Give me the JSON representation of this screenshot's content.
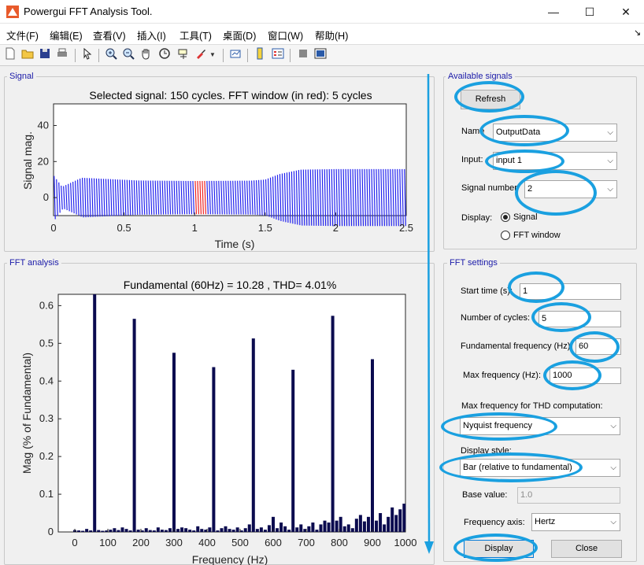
{
  "window": {
    "title": "Powergui FFT Analysis Tool.",
    "minimize": "—",
    "maximize": "☐",
    "close": "✕"
  },
  "menu": [
    "文件(F)",
    "编辑(E)",
    "查看(V)",
    "插入(I)",
    "工具(T)",
    "桌面(D)",
    "窗口(W)",
    "帮助(H)"
  ],
  "menu_arrow": "↘",
  "toolbar_icons": [
    "new-file-icon",
    "open-folder-icon",
    "save-icon",
    "print-icon",
    "pointer-icon",
    "zoom-in-icon",
    "zoom-out-icon",
    "pan-hand-icon",
    "rotate-3d-icon",
    "data-cursor-icon",
    "brush-icon",
    "link-plot-icon",
    "colorbar-icon",
    "legend-icon",
    "hide-plot-tools-icon",
    "show-plot-tools-icon"
  ],
  "signal_panel": {
    "title": "Signal",
    "chart_title": "Selected signal: 150 cycles. FFT window (in red): 5 cycles",
    "xlabel": "Time (s)",
    "ylabel": "Signal mag."
  },
  "fft_panel": {
    "title": "FFT analysis",
    "chart_title": "Fundamental (60Hz) = 10.28 , THD= 4.01%",
    "xlabel": "Frequency (Hz)",
    "ylabel": "Mag (% of Fundamental)"
  },
  "available_signals": {
    "title": "Available signals",
    "refresh": "Refresh",
    "name_label": "Name",
    "name_value": "OutputData",
    "input_label": "Input:",
    "input_value": "input 1",
    "signal_number_label": "Signal number",
    "signal_number_value": "2",
    "display_label": "Display:",
    "display_signal": "Signal",
    "display_fft": "FFT window"
  },
  "fft_settings": {
    "title": "FFT settings",
    "start_time_label": "Start time (s):",
    "start_time_value": "1",
    "cycles_label": "Number of cycles:",
    "cycles_value": "5",
    "fund_freq_label": "Fundamental frequency (Hz):",
    "fund_freq_value": "60",
    "max_freq_label": "Max frequency (Hz):",
    "max_freq_value": "1000",
    "thd_label": "Max frequency for THD computation:",
    "thd_value": "Nyquist frequency",
    "display_style_label": "Display style:",
    "display_style_value": "Bar (relative to fundamental)",
    "base_value_label": "Base value:",
    "base_value_value": "1.0",
    "freq_axis_label": "Frequency axis:",
    "freq_axis_value": "Hertz",
    "display_button": "Display",
    "close_button": "Close"
  },
  "colors": {
    "accent_ring": "#1aa0e0",
    "signal_wave": "#2222ee",
    "fft_window": "#ee2222",
    "bars": "#0b0b4f"
  },
  "chart_data": [
    {
      "type": "line",
      "title": "Selected signal: 150 cycles. FFT window (in red): 5 cycles",
      "xlabel": "Time (s)",
      "ylabel": "Signal mag.",
      "xlim": [
        0,
        2.5
      ],
      "ylim": [
        -10,
        52
      ],
      "xticks": [
        0,
        0.5,
        1,
        1.5,
        2,
        2.5
      ],
      "yticks": [
        0,
        20,
        40
      ],
      "cycles": 150,
      "fft_window": [
        1.0,
        1.0833
      ],
      "envelope": {
        "t": [
          0,
          0.004,
          0.06,
          0.2,
          0.6,
          1.0,
          1.4,
          1.5,
          1.6,
          1.75,
          2.0,
          2.5
        ],
        "amp": [
          48,
          12,
          6,
          11,
          9.5,
          9.2,
          9.4,
          10,
          13,
          15.5,
          15.8,
          15.8
        ]
      },
      "series": [
        {
          "values_note": "oscillating waveform within envelope"
        }
      ]
    },
    {
      "type": "bar",
      "title": "Fundamental (60Hz) = 10.28 , THD= 4.01%",
      "xlabel": "Frequency (Hz)",
      "ylabel": "Mag (% of Fundamental)",
      "xlim": [
        -50,
        1000
      ],
      "ylim": [
        0,
        0.63
      ],
      "xticks": [
        0,
        100,
        200,
        300,
        400,
        500,
        600,
        700,
        800,
        900,
        1000
      ],
      "yticks": [
        0,
        0.1,
        0.2,
        0.3,
        0.4,
        0.5,
        0.6
      ],
      "x": [
        0,
        12,
        24,
        36,
        48,
        60,
        72,
        84,
        96,
        108,
        120,
        132,
        144,
        156,
        168,
        180,
        192,
        204,
        216,
        228,
        240,
        252,
        264,
        276,
        288,
        300,
        312,
        324,
        336,
        348,
        360,
        372,
        384,
        396,
        408,
        420,
        432,
        444,
        456,
        468,
        480,
        492,
        504,
        516,
        528,
        540,
        552,
        564,
        576,
        588,
        600,
        612,
        624,
        636,
        648,
        660,
        672,
        684,
        696,
        708,
        720,
        732,
        744,
        756,
        768,
        780,
        792,
        804,
        816,
        828,
        840,
        852,
        864,
        876,
        888,
        900,
        912,
        924,
        936,
        948,
        960,
        972,
        984,
        996
      ],
      "values": [
        0.005,
        0.004,
        0.003,
        0.008,
        0.004,
        0.63,
        0.005,
        0.003,
        0.004,
        0.006,
        0.01,
        0.005,
        0.012,
        0.008,
        0.004,
        0.565,
        0.006,
        0.004,
        0.01,
        0.005,
        0.004,
        0.012,
        0.006,
        0.005,
        0.01,
        0.475,
        0.008,
        0.012,
        0.01,
        0.006,
        0.004,
        0.015,
        0.008,
        0.006,
        0.012,
        0.437,
        0.004,
        0.01,
        0.015,
        0.008,
        0.006,
        0.012,
        0.004,
        0.01,
        0.02,
        0.513,
        0.008,
        0.012,
        0.006,
        0.018,
        0.04,
        0.01,
        0.025,
        0.015,
        0.006,
        0.43,
        0.012,
        0.02,
        0.008,
        0.015,
        0.025,
        0.006,
        0.02,
        0.03,
        0.025,
        0.573,
        0.03,
        0.04,
        0.015,
        0.02,
        0.01,
        0.035,
        0.045,
        0.028,
        0.04,
        0.458,
        0.03,
        0.05,
        0.02,
        0.04,
        0.065,
        0.045,
        0.06,
        0.075
      ]
    }
  ]
}
